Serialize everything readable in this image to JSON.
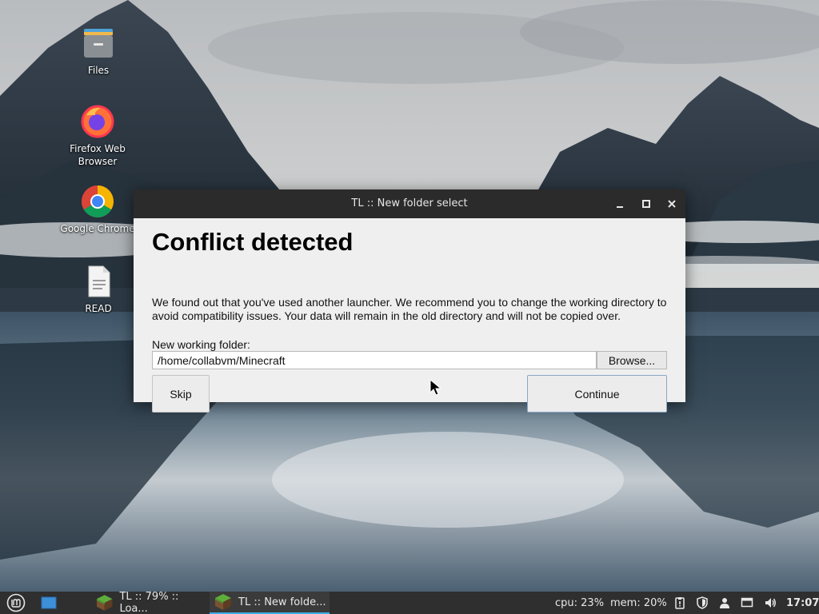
{
  "desktop": {
    "icons": [
      {
        "label": "Files",
        "icon": "files-folder-icon"
      },
      {
        "label": "Firefox Web Browser",
        "icon": "firefox-icon"
      },
      {
        "label": "Google Chrome",
        "icon": "chrome-icon"
      },
      {
        "label": "READ",
        "icon": "text-document-icon"
      }
    ]
  },
  "dialog": {
    "window_title": "TL :: New folder select",
    "heading": "Conflict detected",
    "message": "We found out that you've used another launcher. We recommend you to change the working directory to avoid compatibility issues. Your data will remain in the old directory and will not be copied over.",
    "folder_label": "New working folder:",
    "folder_value": "/home/collabvm/Minecraft",
    "browse_label": "Browse...",
    "skip_label": "Skip",
    "continue_label": "Continue",
    "controls": [
      "minimize-icon",
      "maximize-icon",
      "close-icon"
    ]
  },
  "taskbar": {
    "menu_icon": "mint-menu-icon",
    "show_desktop_icon": "show-desktop-icon",
    "tasks": [
      {
        "label": "TL :: 79% :: Loa...",
        "icon": "minecraft-grass-icon",
        "active": false
      },
      {
        "label": "TL :: New folde...",
        "icon": "minecraft-grass-icon",
        "active": true
      }
    ],
    "cpu": "cpu: 23%",
    "mem": "mem: 20%",
    "tray_icons": [
      "clipboard-icon",
      "shield-icon",
      "user-icon",
      "display-icon",
      "volume-icon"
    ],
    "clock": "17:07"
  },
  "colors": {
    "titlebar": "#2b2b2b",
    "dialog_bg": "#efefef",
    "taskbar": "#2f2f2f",
    "active_task_accent": "#3daee9",
    "continue_border": "#8aa7c7"
  }
}
